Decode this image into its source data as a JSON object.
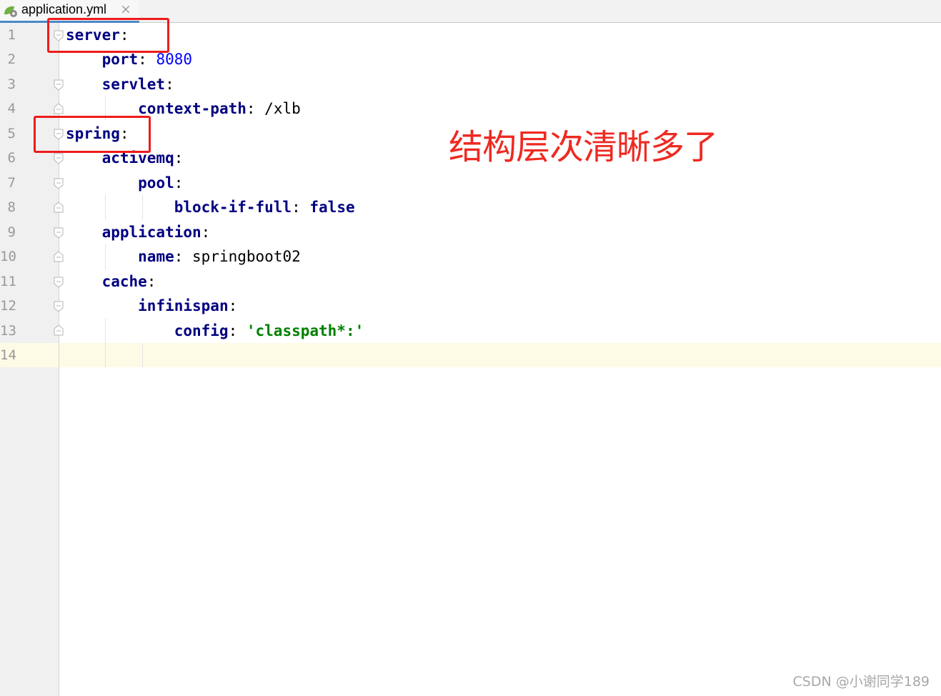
{
  "tab": {
    "title": "application.yml",
    "close": "×"
  },
  "line_numbers": [
    "1",
    "2",
    "3",
    "4",
    "5",
    "6",
    "7",
    "8",
    "9",
    "10",
    "11",
    "12",
    "13",
    "14"
  ],
  "code": {
    "l1": {
      "key": "server",
      "colon": ":"
    },
    "l2": {
      "key": "port",
      "colon": ": ",
      "value": "8080"
    },
    "l3": {
      "key": "servlet",
      "colon": ":"
    },
    "l4": {
      "key": "context-path",
      "colon": ": ",
      "value": "/xlb"
    },
    "l5": {
      "key": "spring",
      "colon": ":"
    },
    "l6": {
      "key": "activemq",
      "colon": ":"
    },
    "l7": {
      "key": "pool",
      "colon": ":"
    },
    "l8": {
      "key": "block-if-full",
      "colon": ": ",
      "value": "false"
    },
    "l9": {
      "key": "application",
      "colon": ":"
    },
    "l10": {
      "key": "name",
      "colon": ": ",
      "value": "springboot02"
    },
    "l11": {
      "key": "cache",
      "colon": ":"
    },
    "l12": {
      "key": "infinispan",
      "colon": ":"
    },
    "l13": {
      "key": "config",
      "colon": ": ",
      "value": "'classpath*:'"
    }
  },
  "annotation": {
    "text": "结构层次清晰多了",
    "color": "#ee1c1c"
  },
  "watermark": "CSDN @小谢同学189",
  "colors": {
    "key": "#000080",
    "number": "#0000ff",
    "string": "#008000",
    "current_line": "#fdfae6"
  }
}
